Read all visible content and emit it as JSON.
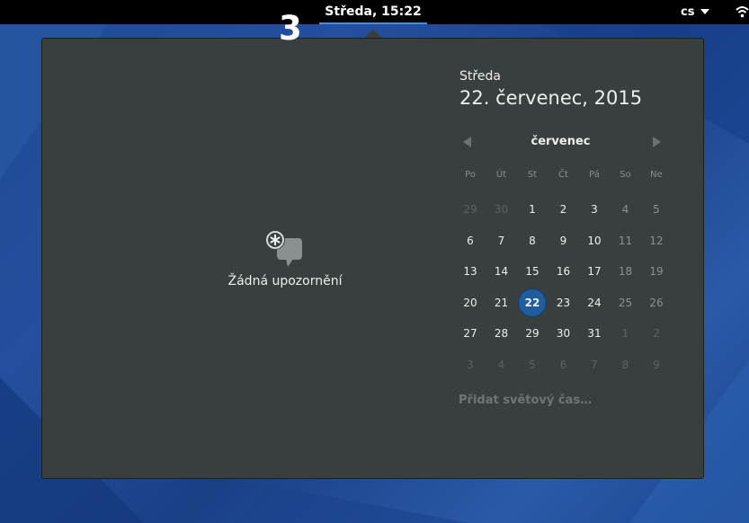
{
  "topbar": {
    "clock_label": "Středa, 15:22",
    "language": "cs"
  },
  "badge": "3",
  "notifications": {
    "empty_text": "Žádná upozornění"
  },
  "date_header": {
    "weekday": "Středa",
    "full_date": "22. červenec, 2015"
  },
  "calendar": {
    "month": "červenec",
    "weekdays": [
      "Po",
      "Út",
      "St",
      "Čt",
      "Pá",
      "So",
      "Ne"
    ],
    "weeks": [
      [
        "29",
        "30",
        "1",
        "2",
        "3",
        "4",
        "5"
      ],
      [
        "6",
        "7",
        "8",
        "9",
        "10",
        "11",
        "12"
      ],
      [
        "13",
        "14",
        "15",
        "16",
        "17",
        "18",
        "19"
      ],
      [
        "20",
        "21",
        "22",
        "23",
        "24",
        "25",
        "26"
      ],
      [
        "27",
        "28",
        "29",
        "30",
        "31",
        "1",
        "2"
      ],
      [
        "3",
        "4",
        "5",
        "6",
        "7",
        "8",
        "9"
      ]
    ],
    "today": "22"
  },
  "world_clock_label": "Přidat světový čas…",
  "colors": {
    "panel_bg": "#393f3f",
    "accent": "#215d9c",
    "topbar": "#000000",
    "desktop": "#1d4a96"
  }
}
